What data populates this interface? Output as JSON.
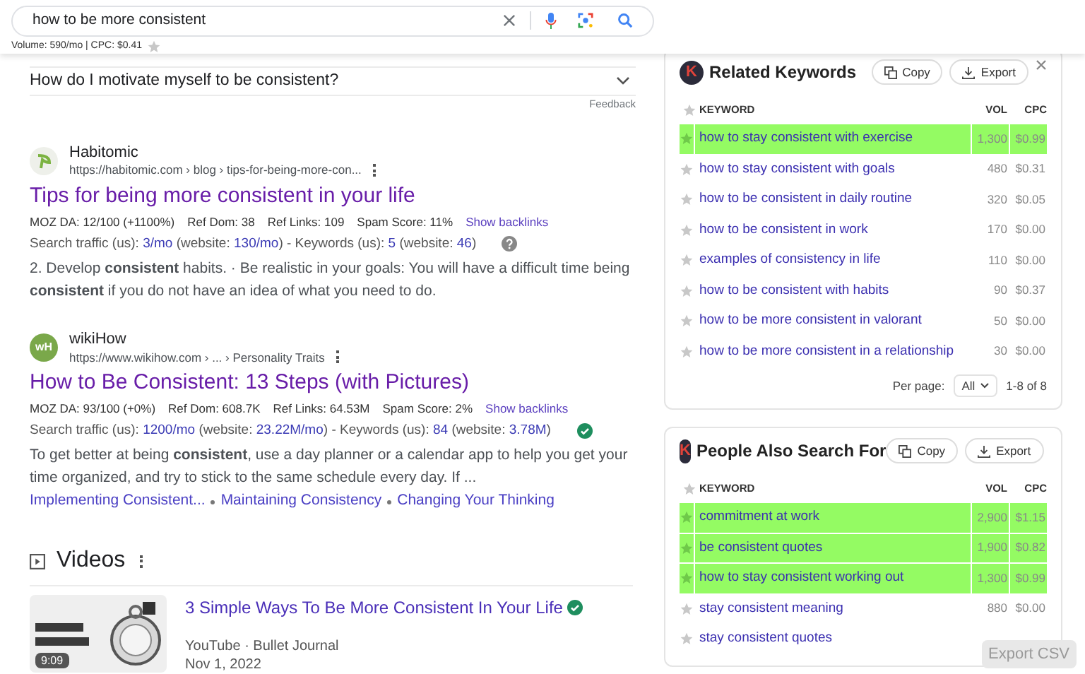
{
  "search": {
    "value": "how to be more consistent",
    "stats": "Volume: 590/mo | CPC: $0.41"
  },
  "faq": {
    "question": "How do I motivate myself to be consistent?",
    "expanded": false,
    "feedback": "Feedback"
  },
  "results": [
    {
      "site": "Habitomic",
      "logo": {
        "kind": "leaf"
      },
      "url": "https://habitomic.com › blog › tips-for-being-more-con...",
      "title": "Tips for being more consistent in your life",
      "metrics": [
        "MOZ DA: 12/100 (+1100%)",
        "Ref Dom: 38",
        "Ref Links: 109",
        "Spam Score: 11%"
      ],
      "backlinks": "Show backlinks",
      "traffic": [
        {
          "text": "Search traffic (us): ",
          "link": false
        },
        {
          "text": "3/mo",
          "link": true
        },
        {
          "text": " (website: ",
          "link": false
        },
        {
          "text": "130/mo",
          "link": true
        },
        {
          "text": ") - Keywords (us): ",
          "link": false
        },
        {
          "text": "5",
          "link": true
        },
        {
          "text": " (website: ",
          "link": false
        },
        {
          "text": "46",
          "link": true
        },
        {
          "text": ")",
          "link": false
        }
      ],
      "verified": false,
      "snippet": "2. Develop **consistent** habits. · Be realistic in your goals: You will have a difficult time being **consistent** if you do not have an idea of what you need to do."
    },
    {
      "site": "wikiHow",
      "logo": {
        "kind": "initials",
        "text": "wH"
      },
      "url": "https://www.wikihow.com › ... › Personality Traits",
      "title": "How to Be Consistent: 13 Steps (with Pictures)",
      "metrics": [
        "MOZ DA: 93/100 (+0%)",
        "Ref Dom: 608.7K",
        "Ref Links: 64.53M",
        "Spam Score: 2%"
      ],
      "backlinks": "Show backlinks",
      "traffic": [
        {
          "text": "Search traffic (us): ",
          "link": false
        },
        {
          "text": "1200/mo",
          "link": true
        },
        {
          "text": " (website: ",
          "link": false
        },
        {
          "text": "23.22M/mo",
          "link": true
        },
        {
          "text": ") - Keywords (us): ",
          "link": false
        },
        {
          "text": "84",
          "link": true
        },
        {
          "text": " (website: ",
          "link": false
        },
        {
          "text": "3.78M",
          "link": true
        },
        {
          "text": ")",
          "link": false
        }
      ],
      "verified": true,
      "snippet": "To get better at being **consistent**, use a day planner or a calendar app to help you get your time organized, and try to stick to the same schedule every day. If ...",
      "sitelinks": [
        "Implementing Consistent...",
        "Maintaining Consistency",
        "Changing Your Thinking"
      ]
    }
  ],
  "videos": {
    "heading": "Videos",
    "items": [
      {
        "title": "3 Simple Ways To Be More Consistent In Your Life",
        "verified": true,
        "duration": "9:09",
        "source": "YouTube · Bullet Journal",
        "date": "Nov 1, 2022"
      }
    ]
  },
  "panels": [
    {
      "logo": "K",
      "title": "Related Keywords",
      "copy": "Copy",
      "export": "Export",
      "columns": [
        "KEYWORD",
        "VOL",
        "CPC"
      ],
      "rows": [
        {
          "keyword": "how to stay consistent with exercise",
          "vol": "1,300",
          "cpc": "$0.99",
          "highlighted": true
        },
        {
          "keyword": "how to stay consistent with goals",
          "vol": "480",
          "cpc": "$0.31",
          "highlighted": false
        },
        {
          "keyword": "how to be consistent in daily routine",
          "vol": "320",
          "cpc": "$0.05",
          "highlighted": false
        },
        {
          "keyword": "how to be consistent in work",
          "vol": "170",
          "cpc": "$0.00",
          "highlighted": false
        },
        {
          "keyword": "examples of consistency in life",
          "vol": "110",
          "cpc": "$0.00",
          "highlighted": false
        },
        {
          "keyword": "how to be consistent with habits",
          "vol": "90",
          "cpc": "$0.37",
          "highlighted": false
        },
        {
          "keyword": "how to be more consistent in valorant",
          "vol": "50",
          "cpc": "$0.00",
          "highlighted": false
        },
        {
          "keyword": "how to be more consistent in a relationship",
          "vol": "30",
          "cpc": "$0.00",
          "highlighted": false
        }
      ],
      "pager": {
        "label": "Per page:",
        "value": "All",
        "range": "1-8 of 8"
      }
    },
    {
      "logo": "K",
      "title": "People Also Search For",
      "copy": "Copy",
      "export": "Export",
      "columns": [
        "KEYWORD",
        "VOL",
        "CPC"
      ],
      "rows": [
        {
          "keyword": "commitment at work",
          "vol": "2,900",
          "cpc": "$1.15",
          "highlighted": true
        },
        {
          "keyword": "be consistent quotes",
          "vol": "1,900",
          "cpc": "$0.82",
          "highlighted": true
        },
        {
          "keyword": "how to stay consistent working out",
          "vol": "1,300",
          "cpc": "$0.99",
          "highlighted": true
        },
        {
          "keyword": "stay consistent meaning",
          "vol": "880",
          "cpc": "$0.00",
          "highlighted": false
        },
        {
          "keyword": "stay consistent quotes",
          "highlighted": false
        }
      ]
    }
  ],
  "export_csv": "Export CSV"
}
